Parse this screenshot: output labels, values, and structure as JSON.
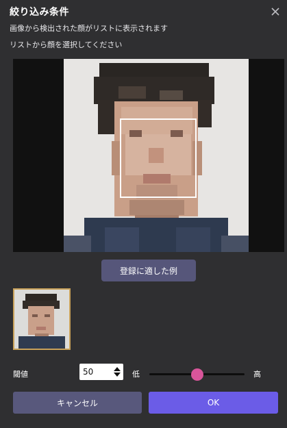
{
  "dialog": {
    "title": "絞り込み条件",
    "subtitle_1": "画像から検出された顔がリストに表示されます",
    "subtitle_2": "リストから顔を選択してください",
    "close_icon": "close-icon"
  },
  "preview": {
    "example_button_label": "登録に適した例"
  },
  "threshold": {
    "label": "閾値",
    "value": "50",
    "low_label": "低",
    "high_label": "高",
    "slider_level_percent": 50
  },
  "actions": {
    "cancel_label": "キャンセル",
    "ok_label": "OK"
  },
  "colors": {
    "background": "#2f2f31",
    "secondary_button": "#58587c",
    "primary_button": "#6b5ce7",
    "slider_thumb": "#d8559a",
    "thumbnail_border": "#c9a25a"
  }
}
